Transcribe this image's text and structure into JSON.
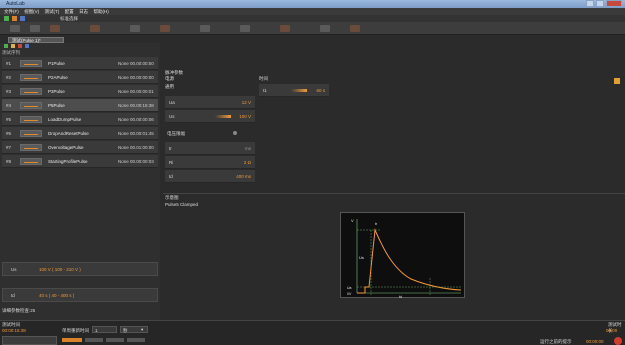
{
  "window": {
    "title": "AutoLab"
  },
  "menu": [
    "文件(F)",
    "视图(V)",
    "测试(T)",
    "配置",
    "日志",
    "帮助(H)"
  ],
  "toolbar": {
    "select_label": "标准选择"
  },
  "doc_tab": "测试(Pulse 1)*",
  "sequence": {
    "header": "测试序列",
    "rows": [
      {
        "num": "#1",
        "name": "P1Pulse",
        "time": "None 00.00:00:50"
      },
      {
        "num": "#2",
        "name": "P2APulse",
        "time": "None 00.00:00:00"
      },
      {
        "num": "#3",
        "name": "P3Pulse",
        "time": "None 00.00:00:01"
      },
      {
        "num": "#4",
        "name": "P5Pulse",
        "time": "None 00.00:15:38"
      },
      {
        "num": "#5",
        "name": "LoadDumpPulse",
        "time": "None 00.00:00:06"
      },
      {
        "num": "#6",
        "name": "DropAndResetPulse",
        "time": "None 00.00:01:45"
      },
      {
        "num": "#7",
        "name": "OvervoltagePulse",
        "time": "None 00.01:00:00"
      },
      {
        "num": "#8",
        "name": "StartingProfilePulse",
        "time": "None 00.00:00:03"
      }
    ],
    "selected_index": 3
  },
  "left_params": [
    {
      "key": "Us",
      "value": "100 V ( 100 - 210 V )"
    },
    {
      "key": "td",
      "value": "40 s ( 40 - 400 s )"
    }
  ],
  "left_footer": "详细参数检查:25",
  "params": {
    "title": "脉冲参数",
    "sub_titles": [
      "电源",
      "时间"
    ],
    "group1_label": "通用",
    "voltage_rows": [
      {
        "key": "Ua",
        "value": "12 V"
      },
      {
        "key": "Us",
        "value": "100 V"
      }
    ],
    "limit_label": "电压限幅",
    "timing_rows": [
      {
        "key": "tr",
        "value": "ms"
      },
      {
        "key": "Ri",
        "value": "2 Ω"
      },
      {
        "key": "td",
        "value": "400 ms"
      }
    ],
    "time_row": {
      "key": "t1",
      "value": "60 s"
    }
  },
  "diagram": {
    "title": "示意图",
    "subtitle": "Pulse5 Clamped",
    "labels": {
      "v": "V",
      "us": "Us",
      "ua": "Ua",
      "zero": "0V",
      "tr": "tr",
      "td": "td"
    }
  },
  "status": {
    "left_label": "测试时间",
    "left_time": "00:00:15:38",
    "mid_label": "单周重新时间",
    "mid_value": "1",
    "unit": "秒",
    "right_label": "运行之前的提示",
    "right_value": "00:00:00",
    "corner_label": "测试时长",
    "corner_value": "00:00"
  },
  "colors": {
    "accent": "#f29a38",
    "background": "#2b2b2b"
  },
  "icons": [
    "window-minimize-icon",
    "window-maximize-icon",
    "window-close-icon",
    "play-icon",
    "stop-icon",
    "record-icon"
  ]
}
